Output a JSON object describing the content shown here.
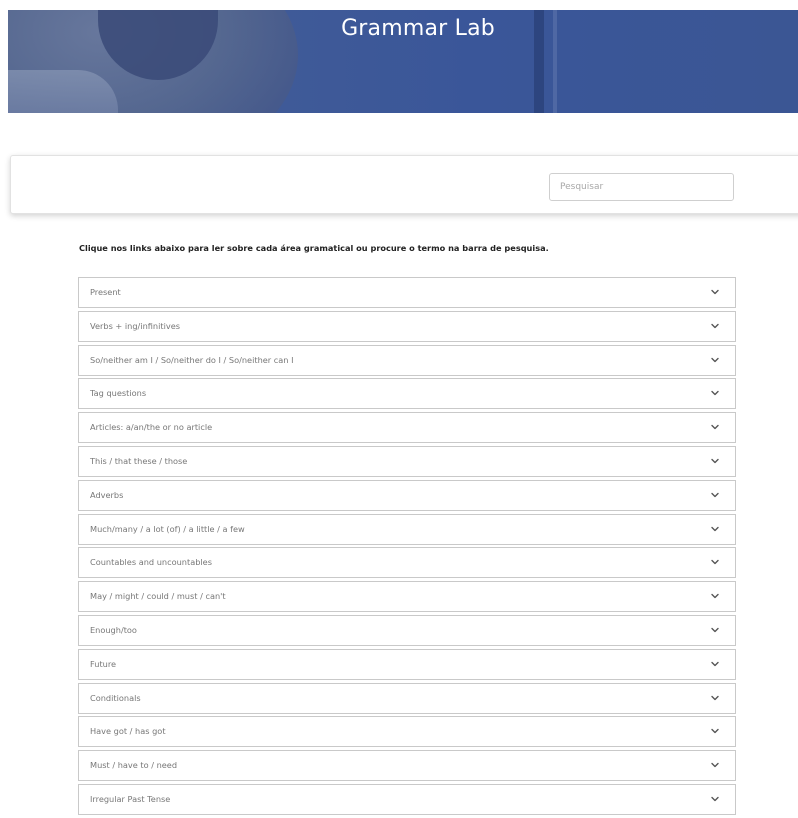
{
  "hero": {
    "title": "Grammar Lab"
  },
  "search": {
    "placeholder": "Pesquisar",
    "value": ""
  },
  "intro": {
    "text": "Clique nos links abaixo para ler sobre cada área gramatical ou procure o termo na barra de pesquisa."
  },
  "accordion": {
    "items": [
      {
        "label": "Present",
        "icon": "chevron-down-icon"
      },
      {
        "label": "Verbs + ing/infinitives",
        "icon": "chevron-down-icon"
      },
      {
        "label": "So/neither am I / So/neither do I / So/neither can I",
        "icon": "chevron-down-icon"
      },
      {
        "label": "Tag questions",
        "icon": "chevron-down-icon"
      },
      {
        "label": "Articles: a/an/the or no article",
        "icon": "chevron-down-icon"
      },
      {
        "label": "This / that these / those",
        "icon": "chevron-down-icon"
      },
      {
        "label": "Adverbs",
        "icon": "chevron-down-icon"
      },
      {
        "label": "Much/many / a lot (of) / a little / a few",
        "icon": "chevron-down-icon"
      },
      {
        "label": "Countables and uncountables",
        "icon": "chevron-down-icon"
      },
      {
        "label": "May / might / could / must / can't",
        "icon": "chevron-down-icon"
      },
      {
        "label": "Enough/too",
        "icon": "chevron-down-icon"
      },
      {
        "label": "Future",
        "icon": "chevron-down-icon"
      },
      {
        "label": "Conditionals",
        "icon": "chevron-down-icon"
      },
      {
        "label": "Have got / has got",
        "icon": "chevron-down-icon"
      },
      {
        "label": "Must / have to / need",
        "icon": "chevron-down-icon"
      },
      {
        "label": "Irregular Past Tense",
        "icon": "chevron-down-icon"
      }
    ]
  },
  "colors": {
    "hero_blue": "#3a5699",
    "text_dark": "#222222",
    "text_muted": "#777777",
    "border": "#c9c9c9"
  }
}
